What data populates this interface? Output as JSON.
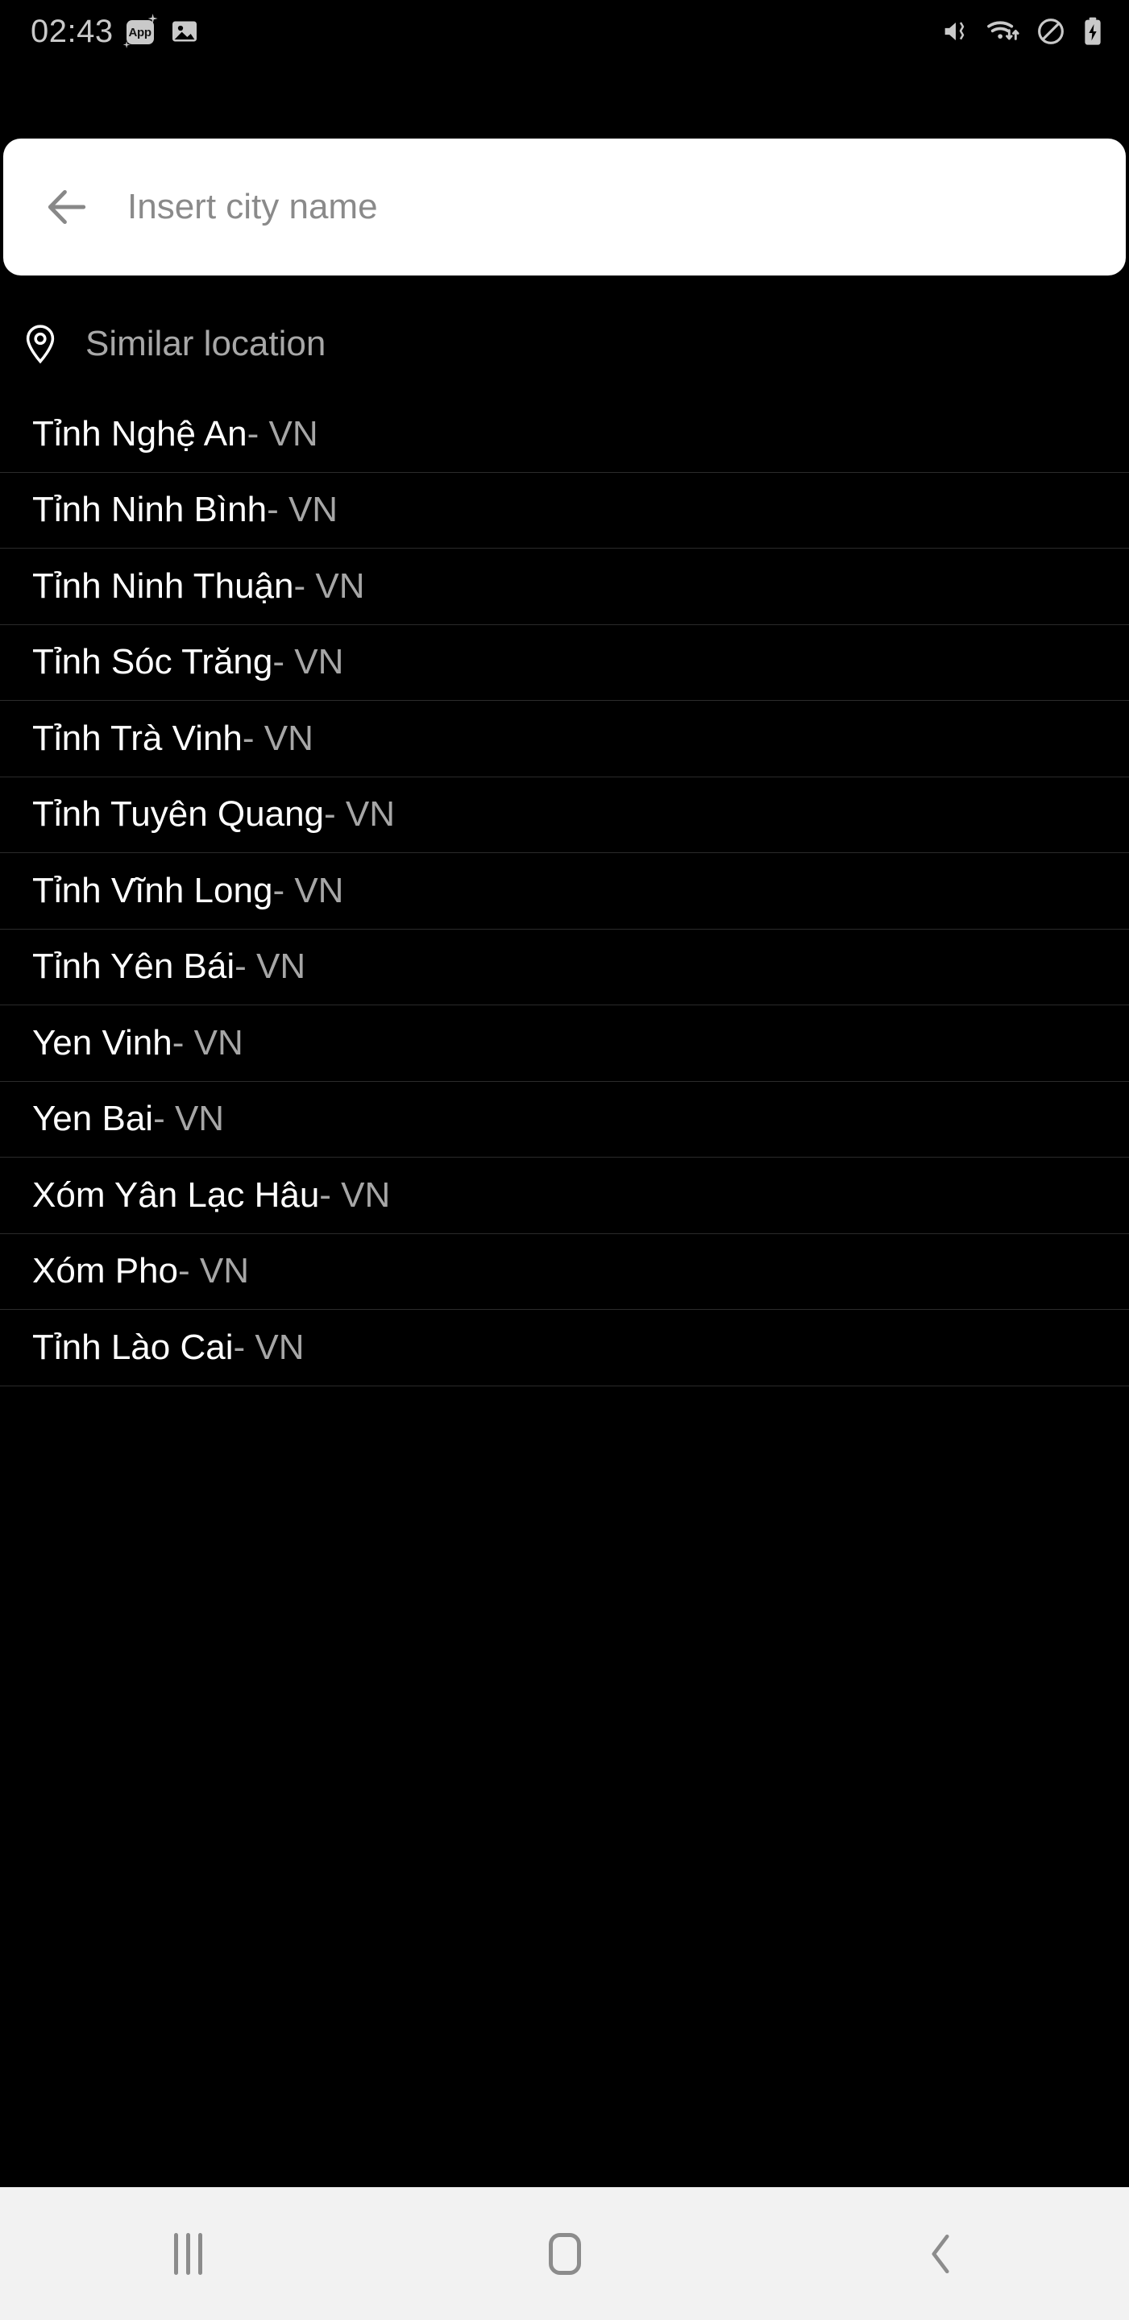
{
  "statusbar": {
    "time": "02:43",
    "left_icons": [
      {
        "name": "app-badge-icon",
        "label": "App"
      },
      {
        "name": "photo-icon",
        "label": "image"
      }
    ],
    "right_icons": [
      {
        "name": "mute-vibrate-icon"
      },
      {
        "name": "wifi-data-icon"
      },
      {
        "name": "do-not-disturb-icon"
      },
      {
        "name": "battery-charging-icon"
      }
    ]
  },
  "search": {
    "placeholder": "Insert city name",
    "value": "",
    "back_icon": "back-arrow-icon"
  },
  "section": {
    "icon": "location-pin-icon",
    "title": "Similar location"
  },
  "results": [
    {
      "name": "Tỉnh Nghệ An",
      "country": "- VN"
    },
    {
      "name": "Tỉnh Ninh Bình",
      "country": "- VN"
    },
    {
      "name": "Tỉnh Ninh Thuận",
      "country": "- VN"
    },
    {
      "name": "Tỉnh Sóc Trăng",
      "country": "- VN"
    },
    {
      "name": "Tỉnh Trà Vinh",
      "country": "- VN"
    },
    {
      "name": "Tỉnh Tuyên Quang",
      "country": "- VN"
    },
    {
      "name": "Tỉnh Vĩnh Long",
      "country": "- VN"
    },
    {
      "name": "Tỉnh Yên Bái",
      "country": "- VN"
    },
    {
      "name": "Yen Vinh",
      "country": "- VN"
    },
    {
      "name": "Yen Bai",
      "country": "- VN"
    },
    {
      "name": "Xóm Yân Lạc Hâu",
      "country": "- VN"
    },
    {
      "name": "Xóm Pho",
      "country": "- VN"
    },
    {
      "name": "Tỉnh Lào Cai",
      "country": "- VN"
    }
  ],
  "navbar": {
    "recents_label": "recents-icon",
    "home_label": "home-icon",
    "back_label": "back-icon"
  },
  "colors": {
    "background": "#000000",
    "search_background": "#ffffff",
    "primary_text": "#ffffff",
    "secondary_text": "#a6a6a6",
    "divider": "#2b2b2b",
    "navbar_background": "#f2f2f2"
  }
}
